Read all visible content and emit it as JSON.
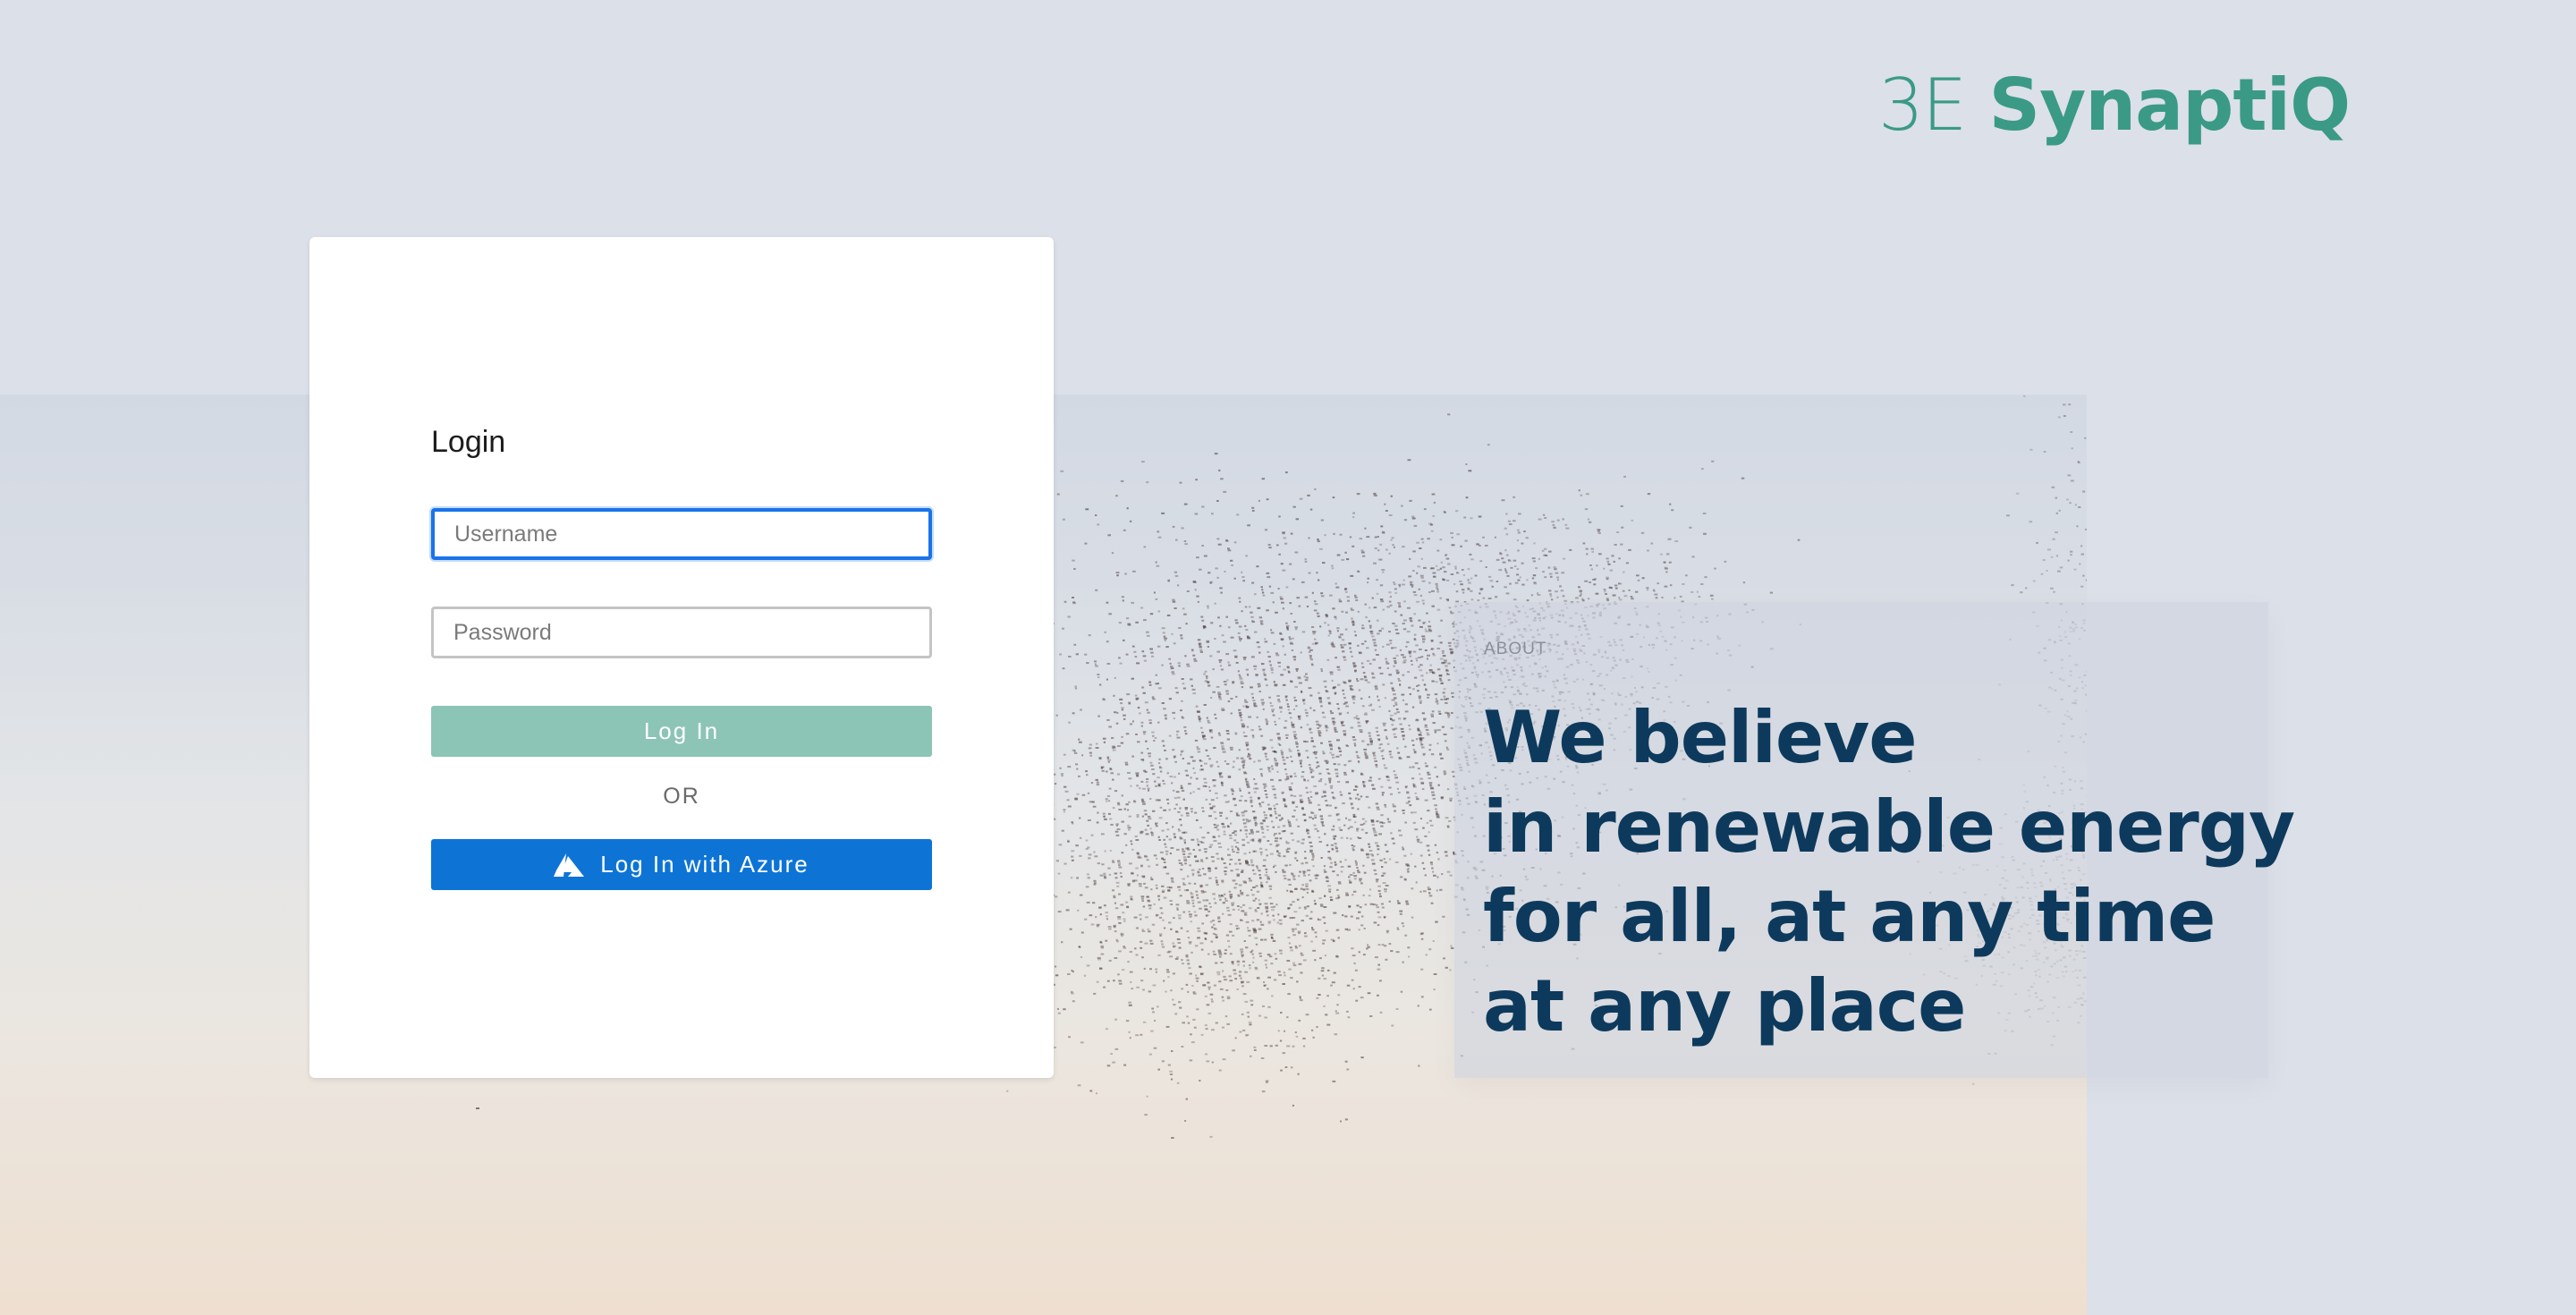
{
  "brand": {
    "logo_prefix": "3E",
    "logo_name": "SynaptiQ",
    "color": "#3a9a86"
  },
  "login": {
    "title": "Login",
    "username_placeholder": "Username",
    "password_placeholder": "Password",
    "login_button": "Log In",
    "login_button_color": "#8cc4b6",
    "or_label": "OR",
    "azure_button": "Log In with Azure",
    "azure_button_color": "#0d74d6",
    "azure_icon": "azure-logo-icon"
  },
  "about": {
    "label": "ABOUT",
    "headline_lines": [
      "We believe",
      "in renewable energy",
      "for all, at any time",
      "at any place"
    ],
    "headline_color": "#0d3a5c"
  }
}
